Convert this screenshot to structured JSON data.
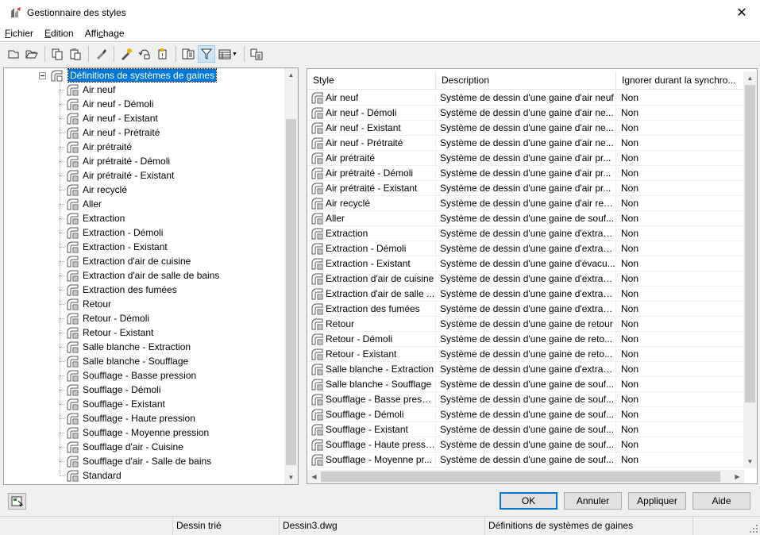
{
  "window": {
    "title": "Gestionnaire des styles",
    "close_glyph": "✕"
  },
  "menu": {
    "items": [
      {
        "label": "Fichier",
        "accel_index": 0
      },
      {
        "label": "Edition",
        "accel_index": 0
      },
      {
        "label": "Affichage",
        "accel_index": 4
      }
    ]
  },
  "toolbar": {
    "icons": [
      "new-icon",
      "open-icon",
      "copy-icon",
      "paste-icon",
      "purge-icon",
      "edit-style-icon",
      "set-current-icon",
      "toggle-view-icon",
      "inventory-icon",
      "filter-icon",
      "view-options-icon",
      "sync-icon"
    ]
  },
  "tree": {
    "root_label": "Définitions de systèmes de gaines",
    "items": [
      "Air neuf",
      "Air neuf - Démoli",
      "Air neuf - Existant",
      "Air neuf - Prétraité",
      "Air prétraité",
      "Air prétraité - Démoli",
      "Air prétraité - Existant",
      "Air recyclé",
      "Aller",
      "Extraction",
      "Extraction - Démoli",
      "Extraction - Existant",
      "Extraction d'air de cuisine",
      "Extraction d'air de salle de bains",
      "Extraction des fumées",
      "Retour",
      "Retour - Démoli",
      "Retour - Existant",
      "Salle blanche - Extraction",
      "Salle blanche - Soufflage",
      "Soufflage - Basse pression",
      "Soufflage - Démoli",
      "Soufflage - Existant",
      "Soufflage - Haute pression",
      "Soufflage - Moyenne pression",
      "Soufflage d'air - Cuisine",
      "Soufflage d'air - Salle de bains",
      "Standard"
    ]
  },
  "grid": {
    "columns": [
      "Style",
      "Description",
      "Ignorer durant la synchro..."
    ],
    "rows": [
      {
        "style": "Air neuf",
        "description": "Système de dessin d'une gaine d'air neuf",
        "ignore": "Non"
      },
      {
        "style": "Air neuf - Démoli",
        "description": "Système de dessin d'une gaine d'air ne...",
        "ignore": "Non"
      },
      {
        "style": "Air neuf - Existant",
        "description": "Système de dessin d'une gaine d'air ne...",
        "ignore": "Non"
      },
      {
        "style": "Air neuf - Prétraité",
        "description": "Système de dessin d'une gaine d'air ne...",
        "ignore": "Non"
      },
      {
        "style": "Air prétraité",
        "description": "Système de dessin d'une gaine d'air pr...",
        "ignore": "Non"
      },
      {
        "style": "Air prétraité - Démoli",
        "description": "Système de dessin d'une gaine d'air pr...",
        "ignore": "Non"
      },
      {
        "style": "Air prétraité - Existant",
        "description": "Système de dessin d'une gaine d'air pr...",
        "ignore": "Non"
      },
      {
        "style": "Air recyclé",
        "description": "Système de dessin d'une gaine d'air rec...",
        "ignore": "Non"
      },
      {
        "style": "Aller",
        "description": "Système de dessin d'une gaine de souf...",
        "ignore": "Non"
      },
      {
        "style": "Extraction",
        "description": "Système de dessin d'une gaine d'extrac...",
        "ignore": "Non"
      },
      {
        "style": "Extraction - Démoli",
        "description": "Système de dessin d'une gaine d'extrac...",
        "ignore": "Non"
      },
      {
        "style": "Extraction - Existant",
        "description": "Système de dessin d'une gaine d'évacu...",
        "ignore": "Non"
      },
      {
        "style": "Extraction d'air de cuisine",
        "description": "Système de dessin d'une gaine d'extrac...",
        "ignore": "Non"
      },
      {
        "style": "Extraction d'air de salle ...",
        "description": "Système de dessin d'une gaine d'extrac...",
        "ignore": "Non"
      },
      {
        "style": "Extraction des fumées",
        "description": "Système de dessin d'une gaine d'extrac...",
        "ignore": "Non"
      },
      {
        "style": "Retour",
        "description": "Système de dessin d'une gaine de retour",
        "ignore": "Non"
      },
      {
        "style": "Retour - Démoli",
        "description": "Système de dessin d'une gaine de reto...",
        "ignore": "Non"
      },
      {
        "style": "Retour - Existant",
        "description": "Système de dessin d'une gaine de reto...",
        "ignore": "Non"
      },
      {
        "style": "Salle blanche - Extraction",
        "description": "Système de dessin d'une gaine d'extrac...",
        "ignore": "Non"
      },
      {
        "style": "Salle blanche - Soufflage",
        "description": "Système de dessin d'une gaine de souf...",
        "ignore": "Non"
      },
      {
        "style": "Soufflage - Basse pression",
        "description": "Système de dessin d'une gaine de souf...",
        "ignore": "Non"
      },
      {
        "style": "Soufflage - Démoli",
        "description": "Système de dessin d'une gaine de souf...",
        "ignore": "Non"
      },
      {
        "style": "Soufflage - Existant",
        "description": "Système de dessin d'une gaine de souf...",
        "ignore": "Non"
      },
      {
        "style": "Soufflage - Haute pressi...",
        "description": "Système de dessin d'une gaine de souf...",
        "ignore": "Non"
      },
      {
        "style": "Soufflage - Moyenne pr...",
        "description": "Système de dessin d'une gaine de souf...",
        "ignore": "Non"
      }
    ]
  },
  "buttons": {
    "ok": "OK",
    "cancel": "Annuler",
    "apply": "Appliquer",
    "help": "Aide"
  },
  "status": {
    "sort": "Dessin trié",
    "file": "Dessin3.dwg",
    "category": "Définitions de systèmes de gaines"
  },
  "colors": {
    "selection": "#0078d7",
    "default_button_border": "#0078d7",
    "filter_active_bg": "#cce4f7"
  }
}
